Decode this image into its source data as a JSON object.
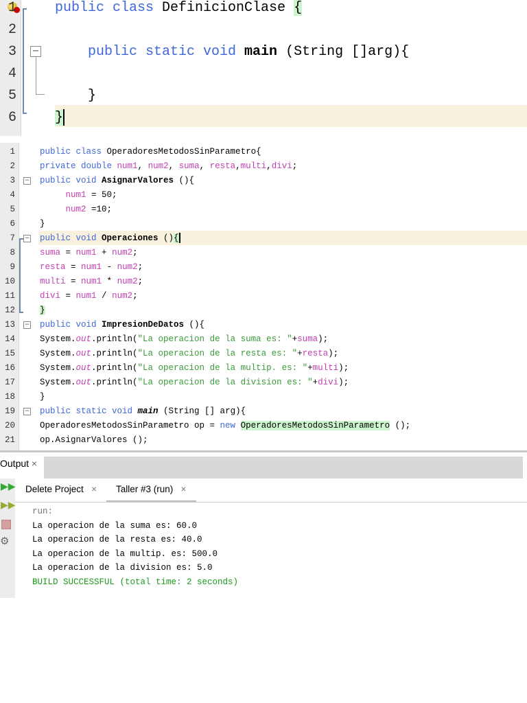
{
  "editor_top": {
    "lines": [
      [
        [
          "kw",
          "public class "
        ],
        [
          "pl",
          "DefinicionClase "
        ],
        [
          "brace",
          "{"
        ]
      ],
      [],
      [
        [
          "kw",
          "    public static void "
        ],
        [
          "meth",
          "main"
        ],
        [
          "pl",
          " (String []arg){"
        ]
      ],
      [],
      [
        [
          "pl",
          "    }"
        ]
      ],
      [
        [
          "brace",
          "}"
        ]
      ]
    ],
    "line_numbers": [
      "1",
      "2",
      "3",
      "4",
      "5",
      "6"
    ]
  },
  "editor_main": {
    "lines": [
      [
        [
          "kw",
          "public class "
        ],
        [
          "pl",
          "OperadoresMetodosSinParametro{"
        ]
      ],
      [
        [
          "kw",
          "private double "
        ],
        [
          "fld",
          "num1"
        ],
        [
          "pl",
          ", "
        ],
        [
          "fld",
          "num2"
        ],
        [
          "pl",
          ", "
        ],
        [
          "fld",
          "suma"
        ],
        [
          "pl",
          ", "
        ],
        [
          "fld",
          "resta"
        ],
        [
          "pl",
          ","
        ],
        [
          "fld",
          "multi"
        ],
        [
          "pl",
          ","
        ],
        [
          "fld",
          "divi"
        ],
        [
          "pl",
          ";"
        ]
      ],
      [
        [
          "kw",
          "public void "
        ],
        [
          "meth",
          "AsignarValores"
        ],
        [
          "pl",
          " (){"
        ]
      ],
      [
        [
          "fld",
          "     num1"
        ],
        [
          "pl",
          " = 50;"
        ]
      ],
      [
        [
          "fld",
          "     num2"
        ],
        [
          "pl",
          " =10;"
        ]
      ],
      [
        [
          "pl",
          "}"
        ]
      ],
      [
        [
          "kw",
          "public void "
        ],
        [
          "meth",
          "Operaciones"
        ],
        [
          "pl",
          " ()"
        ],
        [
          "brace",
          "{"
        ]
      ],
      [
        [
          "fld",
          "suma"
        ],
        [
          "pl",
          " = "
        ],
        [
          "fld",
          "num1"
        ],
        [
          "pl",
          " + "
        ],
        [
          "fld",
          "num2"
        ],
        [
          "pl",
          ";"
        ]
      ],
      [
        [
          "fld",
          "resta"
        ],
        [
          "pl",
          " = "
        ],
        [
          "fld",
          "num1"
        ],
        [
          "pl",
          " - "
        ],
        [
          "fld",
          "num2"
        ],
        [
          "pl",
          ";"
        ]
      ],
      [
        [
          "fld",
          "multi"
        ],
        [
          "pl",
          " = "
        ],
        [
          "fld",
          "num1"
        ],
        [
          "pl",
          " * "
        ],
        [
          "fld",
          "num2"
        ],
        [
          "pl",
          ";"
        ]
      ],
      [
        [
          "fld",
          "divi"
        ],
        [
          "pl",
          " = "
        ],
        [
          "fld",
          "num1"
        ],
        [
          "pl",
          " / "
        ],
        [
          "fld",
          "num2"
        ],
        [
          "pl",
          ";"
        ]
      ],
      [
        [
          "brace",
          "}"
        ]
      ],
      [
        [
          "kw",
          "public void "
        ],
        [
          "meth",
          "ImpresionDeDatos"
        ],
        [
          "pl",
          " (){"
        ]
      ],
      [
        [
          "pl",
          "System."
        ],
        [
          "fld it",
          "out"
        ],
        [
          "pl",
          ".println("
        ],
        [
          "str",
          "\"La operacion de la suma es: \""
        ],
        [
          "pl",
          "+"
        ],
        [
          "fld",
          "suma"
        ],
        [
          "pl",
          ");"
        ]
      ],
      [
        [
          "pl",
          "System."
        ],
        [
          "fld it",
          "out"
        ],
        [
          "pl",
          ".println("
        ],
        [
          "str",
          "\"La operacion de la resta es: \""
        ],
        [
          "pl",
          "+"
        ],
        [
          "fld",
          "resta"
        ],
        [
          "pl",
          ");"
        ]
      ],
      [
        [
          "pl",
          "System."
        ],
        [
          "fld it",
          "out"
        ],
        [
          "pl",
          ".println("
        ],
        [
          "str",
          "\"La operacion de la multip. es: \""
        ],
        [
          "pl",
          "+"
        ],
        [
          "fld",
          "multi"
        ],
        [
          "pl",
          ");"
        ]
      ],
      [
        [
          "pl",
          "System."
        ],
        [
          "fld it",
          "out"
        ],
        [
          "pl",
          ".println("
        ],
        [
          "str",
          "\"La operacion de la division es: \""
        ],
        [
          "pl",
          "+"
        ],
        [
          "fld",
          "divi"
        ],
        [
          "pl",
          ");"
        ]
      ],
      [
        [
          "pl",
          "}"
        ]
      ],
      [
        [
          "kw",
          "public static void "
        ],
        [
          "meth it",
          "main"
        ],
        [
          "pl",
          " (String [] arg){"
        ]
      ],
      [
        [
          "pl",
          "OperadoresMetodosSinParametro op = "
        ],
        [
          "kw",
          "new "
        ],
        [
          "brace",
          "OperadoresMetodosSinParametro"
        ],
        [
          "pl",
          " ();"
        ]
      ],
      [
        [
          "pl",
          "op.AsignarValores ();"
        ]
      ]
    ],
    "line_numbers": [
      "1",
      "2",
      "3",
      "4",
      "5",
      "6",
      "7",
      "8",
      "9",
      "10",
      "11",
      "12",
      "13",
      "14",
      "15",
      "16",
      "17",
      "18",
      "19",
      "20",
      "21"
    ]
  },
  "output": {
    "tab_label": "Output",
    "subtabs": [
      {
        "label": "Delete Project"
      },
      {
        "label": "Taller #3 (run)"
      }
    ],
    "lines": [
      {
        "text": "run:",
        "color": "#777777"
      },
      {
        "text": "La operacion de la suma es: 60.0",
        "color": "#000000"
      },
      {
        "text": "La operacion de la resta es: 40.0",
        "color": "#000000"
      },
      {
        "text": "La operacion de la multip. es: 500.0",
        "color": "#000000"
      },
      {
        "text": "La operacion de la division es: 5.0",
        "color": "#000000"
      },
      {
        "text": "BUILD SUCCESSFUL (total time: 2 seconds)",
        "color": "#1a9a1a"
      }
    ],
    "close_glyph": "×"
  }
}
